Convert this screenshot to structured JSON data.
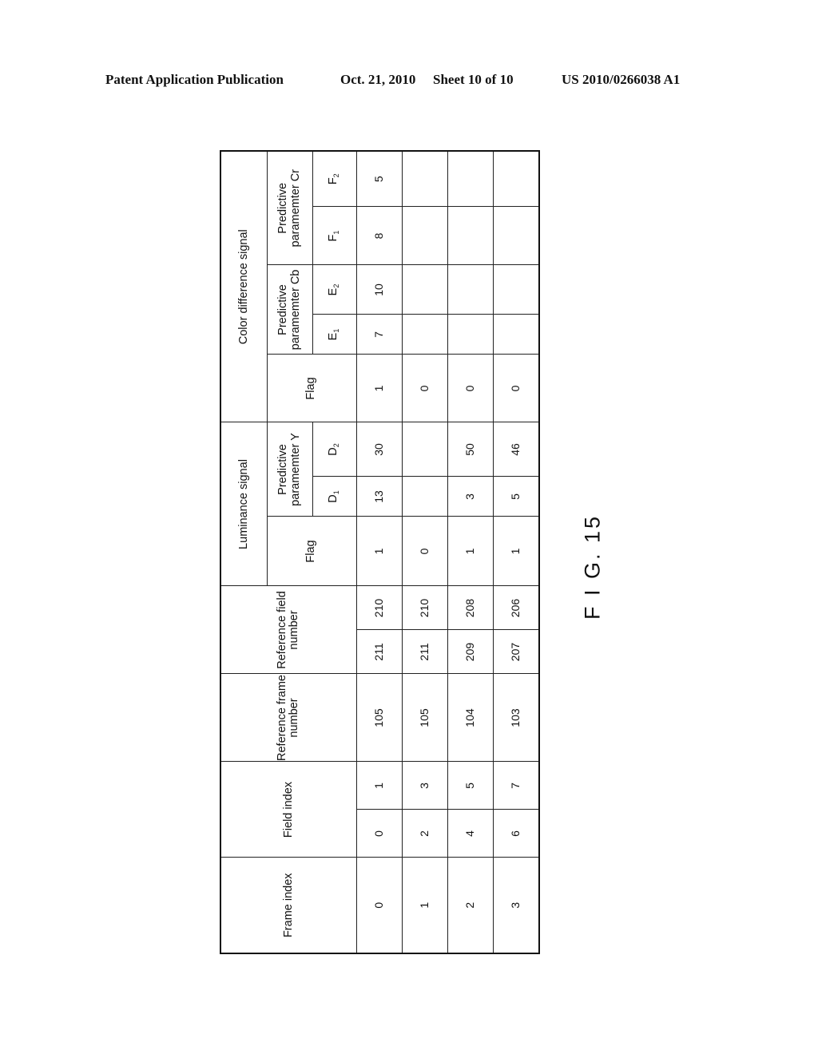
{
  "header": {
    "publication": "Patent Application Publication",
    "date": "Oct. 21, 2010",
    "sheet": "Sheet 10 of 10",
    "number": "US 2010/0266038 A1"
  },
  "figure": {
    "label": "F I G. 15"
  },
  "table": {
    "headers": {
      "frame_index": "Frame index",
      "field_index": "Field index",
      "ref_frame": "Reference frame number",
      "ref_field": "Reference field number",
      "luminance": "Luminance signal",
      "chroma": "Color difference signal",
      "flag": "Flag",
      "pred_y": "Predictive paramemter Y",
      "pred_cb": "Predictive paramemter Cb",
      "pred_cr": "Predictive paramemter Cr",
      "d1": "D",
      "d1_sub": "1",
      "d2": "D",
      "d2_sub": "2",
      "e1": "E",
      "e1_sub": "1",
      "e2": "E",
      "e2_sub": "2",
      "f1": "F",
      "f1_sub": "1",
      "f2": "F",
      "f2_sub": "2"
    },
    "rows": [
      {
        "frame": "0",
        "fields": [
          "0",
          "1"
        ],
        "ref_frame": "105",
        "ref_fields": [
          "211",
          "210"
        ],
        "lum_flag": "1",
        "d1": "13",
        "d2": "30",
        "chroma_flag": "1",
        "e1": "7",
        "e2": "10",
        "f1": "8",
        "f2": "5"
      },
      {
        "frame": "1",
        "fields": [
          "2",
          "3"
        ],
        "ref_frame": "105",
        "ref_fields": [
          "211",
          "210"
        ],
        "lum_flag": "0",
        "d1": "",
        "d2": "",
        "chroma_flag": "0",
        "e1": "",
        "e2": "",
        "f1": "",
        "f2": ""
      },
      {
        "frame": "2",
        "fields": [
          "4",
          "5"
        ],
        "ref_frame": "104",
        "ref_fields": [
          "209",
          "208"
        ],
        "lum_flag": "1",
        "d1": "3",
        "d2": "50",
        "chroma_flag": "0",
        "e1": "",
        "e2": "",
        "f1": "",
        "f2": ""
      },
      {
        "frame": "3",
        "fields": [
          "6",
          "7"
        ],
        "ref_frame": "103",
        "ref_fields": [
          "207",
          "206"
        ],
        "lum_flag": "1",
        "d1": "5",
        "d2": "46",
        "chroma_flag": "0",
        "e1": "",
        "e2": "",
        "f1": "",
        "f2": ""
      }
    ]
  }
}
